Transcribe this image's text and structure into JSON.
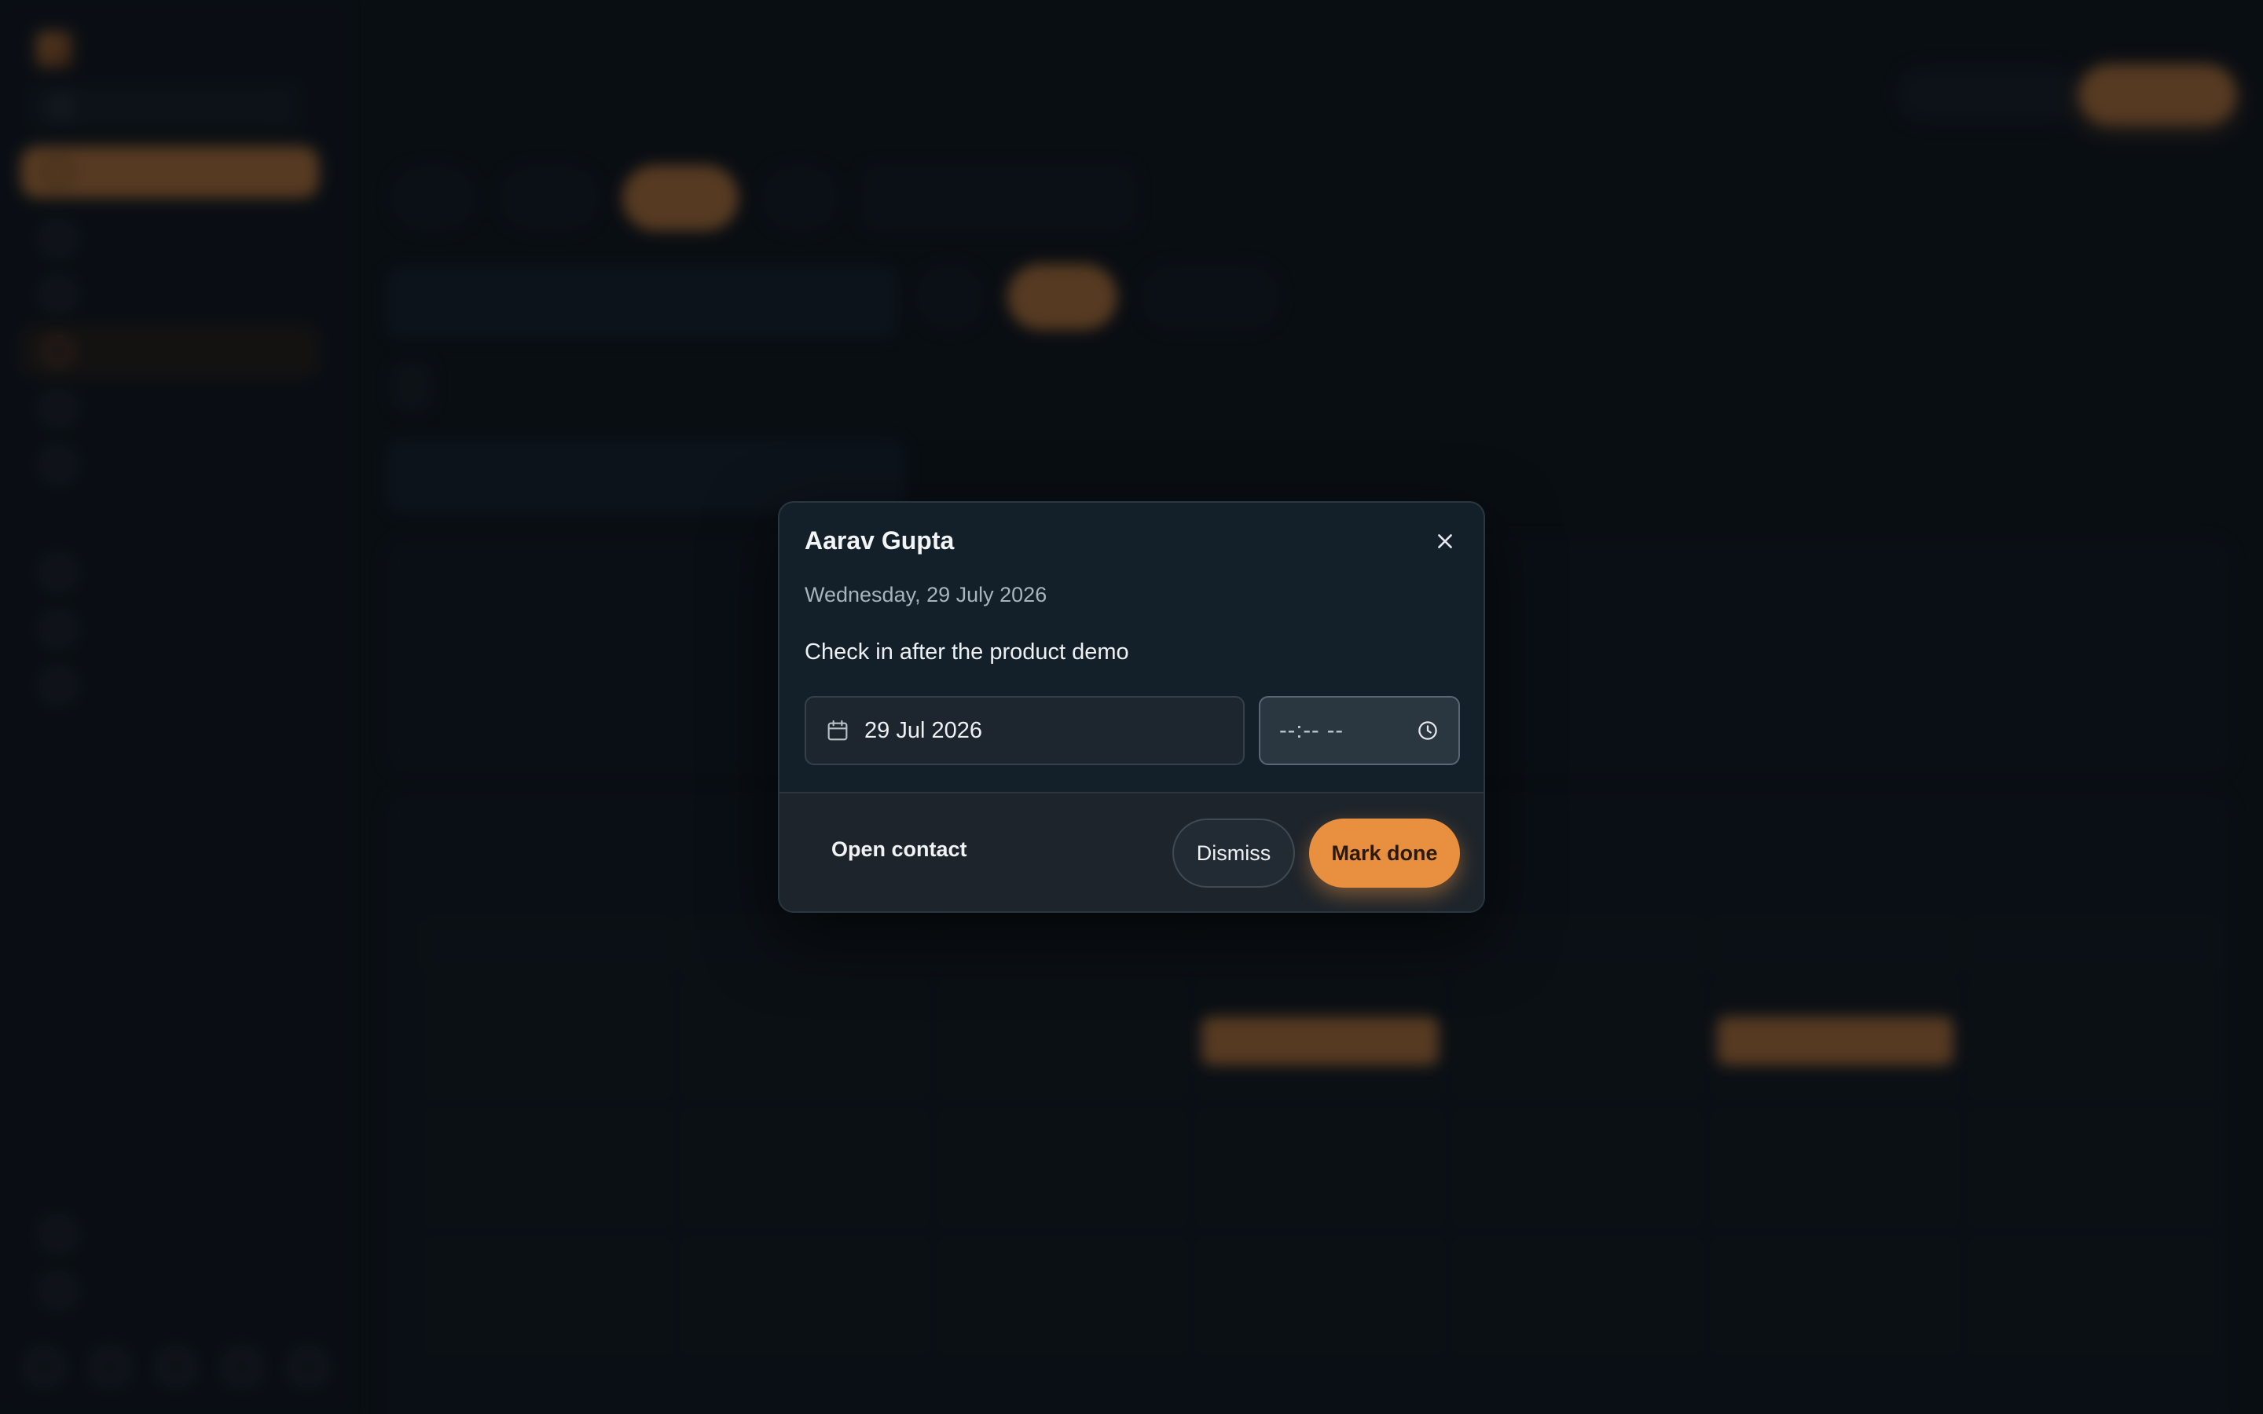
{
  "modal": {
    "title": "Aarav Gupta",
    "date_text": "Wednesday, 29 July 2026",
    "note": "Check in after the product demo",
    "date_value": "29 Jul 2026",
    "time_placeholder": "--:-- --",
    "open_contact_label": "Open contact",
    "dismiss_label": "Dismiss",
    "mark_done_label": "Mark done"
  },
  "colors": {
    "accent": "#e8903f",
    "background": "#0c1116",
    "modal_bg": "#13202a"
  },
  "icons": {
    "close": "close-icon",
    "calendar": "calendar-icon",
    "clock": "clock-icon"
  }
}
